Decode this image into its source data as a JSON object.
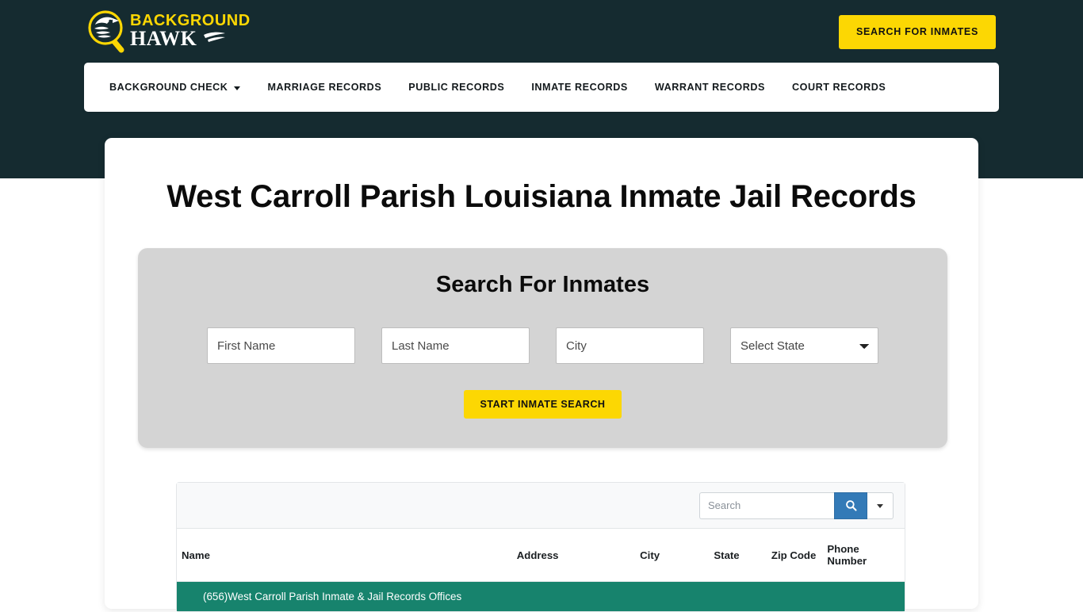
{
  "theme": {
    "header_bg": "#152b30",
    "accent_yellow": "#FCD703",
    "group_row_green": "#17836D",
    "search_btn_blue": "#337ab7",
    "panel_gray": "#d4d4d4"
  },
  "brand": {
    "line1": "BACKGROUND",
    "line2": "HAWK",
    "logo_icon": "magnifier-hawk-logo"
  },
  "header": {
    "cta_label": "SEARCH FOR INMATES"
  },
  "nav": {
    "items": [
      {
        "label": "BACKGROUND CHECK",
        "has_dropdown": true
      },
      {
        "label": "MARRIAGE RECORDS",
        "has_dropdown": false
      },
      {
        "label": "PUBLIC RECORDS",
        "has_dropdown": false
      },
      {
        "label": "INMATE RECORDS",
        "has_dropdown": false
      },
      {
        "label": "WARRANT RECORDS",
        "has_dropdown": false
      },
      {
        "label": "COURT RECORDS",
        "has_dropdown": false
      }
    ]
  },
  "main": {
    "page_title": "West Carroll Parish Louisiana Inmate Jail Records",
    "search_panel": {
      "heading": "Search For Inmates",
      "first_name_placeholder": "First Name",
      "first_name_value": "",
      "last_name_placeholder": "Last Name",
      "last_name_value": "",
      "city_placeholder": "City",
      "city_value": "",
      "state_selected": "Select State",
      "state_options": [
        "Select State"
      ],
      "submit_label": "START INMATE SEARCH"
    },
    "table": {
      "search_placeholder": "Search",
      "search_value": "",
      "columns": [
        "Name",
        "Address",
        "City",
        "State",
        "Zip Code",
        "Phone Number"
      ],
      "group_rows": [
        {
          "label": "(656)West Carroll Parish Inmate & Jail Records Offices"
        }
      ]
    }
  }
}
